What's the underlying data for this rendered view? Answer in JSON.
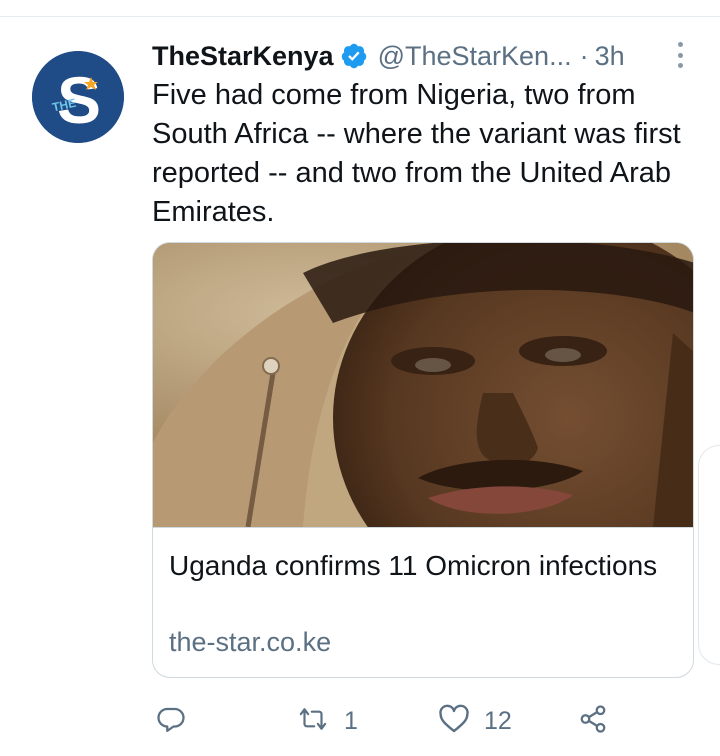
{
  "tweet": {
    "account_name": "TheStarKenya",
    "handle": "@TheStarKen...",
    "separator": "·",
    "time": "3h",
    "text": "Five had come from Nigeria, two from South Africa -- where the variant was first reported -- and two from the United Arab Emirates."
  },
  "avatar": {
    "letter": "S",
    "small_text": "THE"
  },
  "card": {
    "title": "Uganda confirms 11 Omicron infections",
    "domain": "the-star.co.ke"
  },
  "actions": {
    "reply_count": "",
    "retweet_count": "1",
    "like_count": "12"
  },
  "icons": {
    "verified": "verified-badge-icon",
    "more": "more-vertical-icon",
    "reply": "reply-icon",
    "retweet": "retweet-icon",
    "like": "heart-icon",
    "share": "share-icon"
  },
  "colors": {
    "accent": "#1d9bf0",
    "secondary_text": "#5b7083",
    "avatar_bg": "#1f4b86",
    "avatar_star": "#f5a623"
  }
}
